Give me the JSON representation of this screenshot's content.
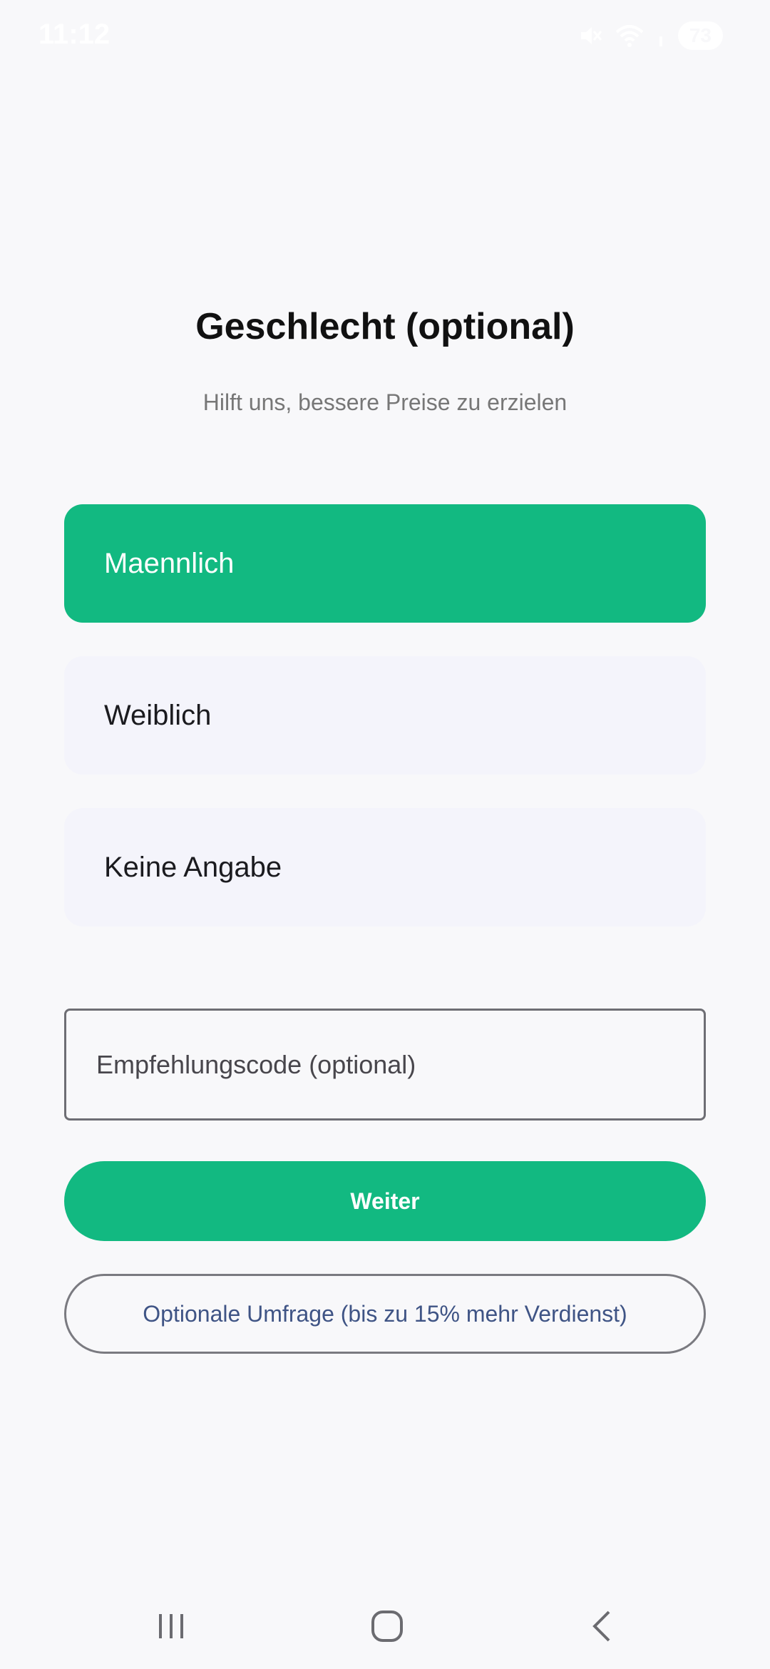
{
  "status_bar": {
    "time": "11:12",
    "battery": "73",
    "icons": [
      "mute-icon",
      "wifi-icon",
      "signal-icon",
      "battery-icon"
    ]
  },
  "screen": {
    "title": "Geschlecht (optional)",
    "subtitle": "Hilft uns, bessere Preise zu erzielen"
  },
  "options": [
    {
      "label": "Maennlich",
      "selected": true
    },
    {
      "label": "Weiblich",
      "selected": false
    },
    {
      "label": "Keine Angabe",
      "selected": false
    }
  ],
  "referral": {
    "placeholder": "Empfehlungscode (optional)",
    "value": ""
  },
  "buttons": {
    "next": "Weiter",
    "survey": "Optionale Umfrage (bis zu 15% mehr Verdienst)"
  },
  "nav_bar": {
    "icons": [
      "recents-icon",
      "home-icon",
      "back-icon"
    ]
  },
  "colors": {
    "accent": "#12b981",
    "background": "#f8f8fa",
    "unselected_option": "#f4f4fb",
    "survey_text": "#3f5485"
  }
}
